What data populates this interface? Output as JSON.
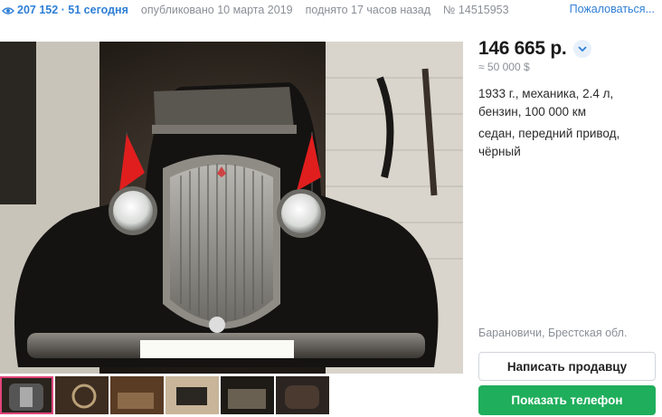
{
  "meta": {
    "views": "207 152 · 51 сегодня",
    "published": "опубликовано 10 марта 2019",
    "raised": "поднято 17 часов назад",
    "ad_number": "№ 14515953",
    "complain_label": "Пожаловаться..."
  },
  "listing": {
    "price": "146 665 р.",
    "price_usd": "≈ 50 000 $",
    "specs_line1": "1933 г., механика, 2.4 л, бензин, 100 000 км",
    "specs_line2": "седан, передний привод, чёрный",
    "location": "Барановичи, Брестская обл."
  },
  "actions": {
    "write_seller": "Написать продавцу",
    "show_phone": "Показать телефон"
  },
  "gallery": {
    "main_image": "vintage-black-car-front-in-garage-photo",
    "thumbnails": [
      "car-front-thumb",
      "steering-wheel-thumb",
      "interior-thumb",
      "side-view-thumb",
      "engine-thumb",
      "car-rear-thumb"
    ],
    "active_index": 0
  },
  "colors": {
    "accent_blue": "#2f7fd6",
    "phone_green": "#1fae5b",
    "active_thumb": "#e0457a",
    "muted_text": "#8a8f96"
  }
}
